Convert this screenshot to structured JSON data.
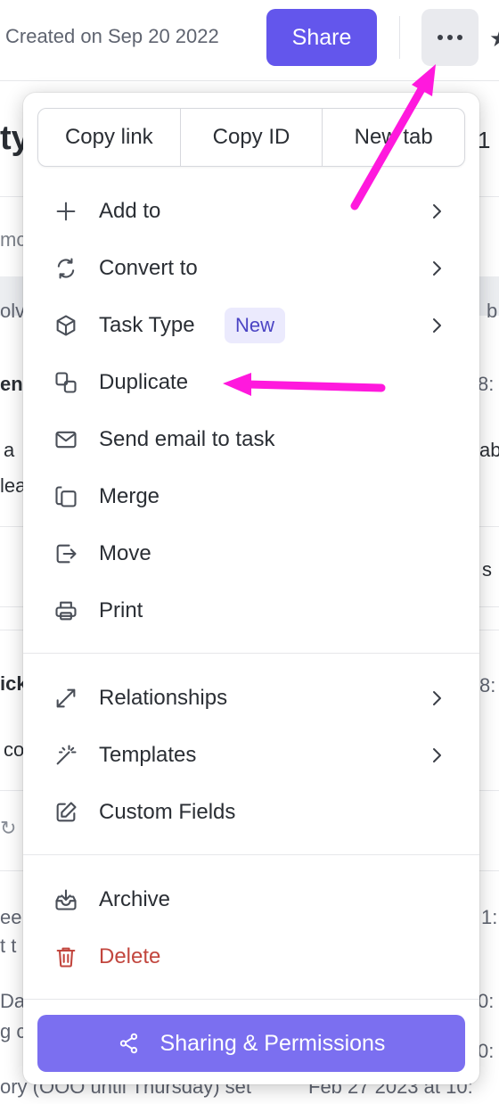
{
  "header": {
    "created_text": "Created on Sep 20 2022",
    "share_label": "Share",
    "more_icon": "more-horizontal-icon"
  },
  "background": {
    "fragments": [
      "ty",
      "1",
      "mc",
      "olv",
      "b",
      "en",
      "8:",
      "a",
      "ab",
      "lea",
      "s",
      "ick",
      "8:",
      "co",
      "een",
      "1:",
      "t t",
      "Dar",
      "0:",
      "g c",
      "0:"
    ],
    "bottom_text": "ory (OOO until Thursday)  set",
    "bottom_date": "Feb 27 2023 at 10:"
  },
  "menu": {
    "copy_buttons": [
      "Copy link",
      "Copy ID",
      "New tab"
    ],
    "section1": [
      {
        "label": "Add to",
        "icon": "plus-icon",
        "submenu": true
      },
      {
        "label": "Convert to",
        "icon": "convert-icon",
        "submenu": true
      },
      {
        "label": "Task Type",
        "icon": "cube-icon",
        "submenu": true,
        "badge": "New"
      },
      {
        "label": "Duplicate",
        "icon": "duplicate-icon",
        "submenu": false
      },
      {
        "label": "Send email to task",
        "icon": "mail-icon",
        "submenu": false
      },
      {
        "label": "Merge",
        "icon": "merge-icon",
        "submenu": false
      },
      {
        "label": "Move",
        "icon": "move-icon",
        "submenu": false
      },
      {
        "label": "Print",
        "icon": "printer-icon",
        "submenu": false
      }
    ],
    "section2": [
      {
        "label": "Relationships",
        "icon": "relationships-icon",
        "submenu": true
      },
      {
        "label": "Templates",
        "icon": "magic-wand-icon",
        "submenu": true
      },
      {
        "label": "Custom Fields",
        "icon": "edit-icon",
        "submenu": false
      }
    ],
    "section3": [
      {
        "label": "Archive",
        "icon": "archive-icon"
      },
      {
        "label": "Delete",
        "icon": "trash-icon"
      }
    ],
    "sharing_label": "Sharing & Permissions",
    "sharing_icon": "share-nodes-icon"
  },
  "colors": {
    "primary": "#6356ec",
    "sharing_button": "#7b6ff0",
    "badge_bg": "#ebeafd",
    "badge_text": "#4b44c4",
    "delete": "#c2463e",
    "annotation_arrow": "#ff19dd"
  }
}
